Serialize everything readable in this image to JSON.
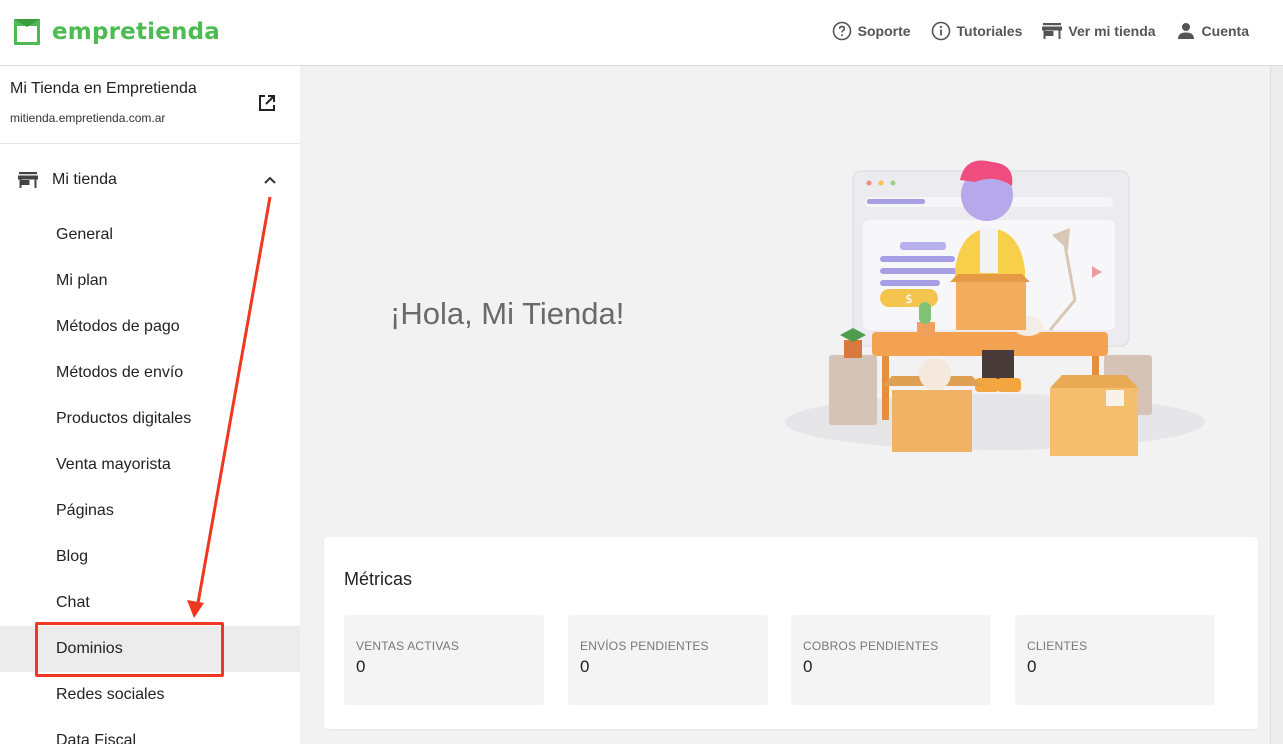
{
  "header": {
    "brand": "empretienda",
    "nav": [
      {
        "label": "Soporte",
        "icon": "help-circle-icon"
      },
      {
        "label": "Tutoriales",
        "icon": "info-circle-icon"
      },
      {
        "label": "Ver mi tienda",
        "icon": "storefront-icon"
      },
      {
        "label": "Cuenta",
        "icon": "person-icon"
      }
    ]
  },
  "sidebar": {
    "store_name": "Mi Tienda en Empretienda",
    "store_url": "mitienda.empretienda.com.ar",
    "section_label": "Mi tienda",
    "items": [
      {
        "label": "General"
      },
      {
        "label": "Mi plan"
      },
      {
        "label": "Métodos de pago"
      },
      {
        "label": "Métodos de envío"
      },
      {
        "label": "Productos digitales"
      },
      {
        "label": "Venta mayorista"
      },
      {
        "label": "Páginas"
      },
      {
        "label": "Blog"
      },
      {
        "label": "Chat"
      },
      {
        "label": "Dominios",
        "active": true
      },
      {
        "label": "Redes sociales"
      },
      {
        "label": "Data Fiscal"
      }
    ]
  },
  "main": {
    "greeting": "¡Hola, Mi Tienda!",
    "illustration_price_symbol": "$",
    "metrics": {
      "title": "Métricas",
      "items": [
        {
          "label": "VENTAS ACTIVAS",
          "value": "0"
        },
        {
          "label": "ENVÍOS PENDIENTES",
          "value": "0"
        },
        {
          "label": "COBROS PENDIENTES",
          "value": "0"
        },
        {
          "label": "CLIENTES",
          "value": "0"
        }
      ]
    }
  },
  "colors": {
    "brand_green": "#4bbb52",
    "highlight_red": "#f0371f",
    "active_item_bg": "#ececec"
  }
}
